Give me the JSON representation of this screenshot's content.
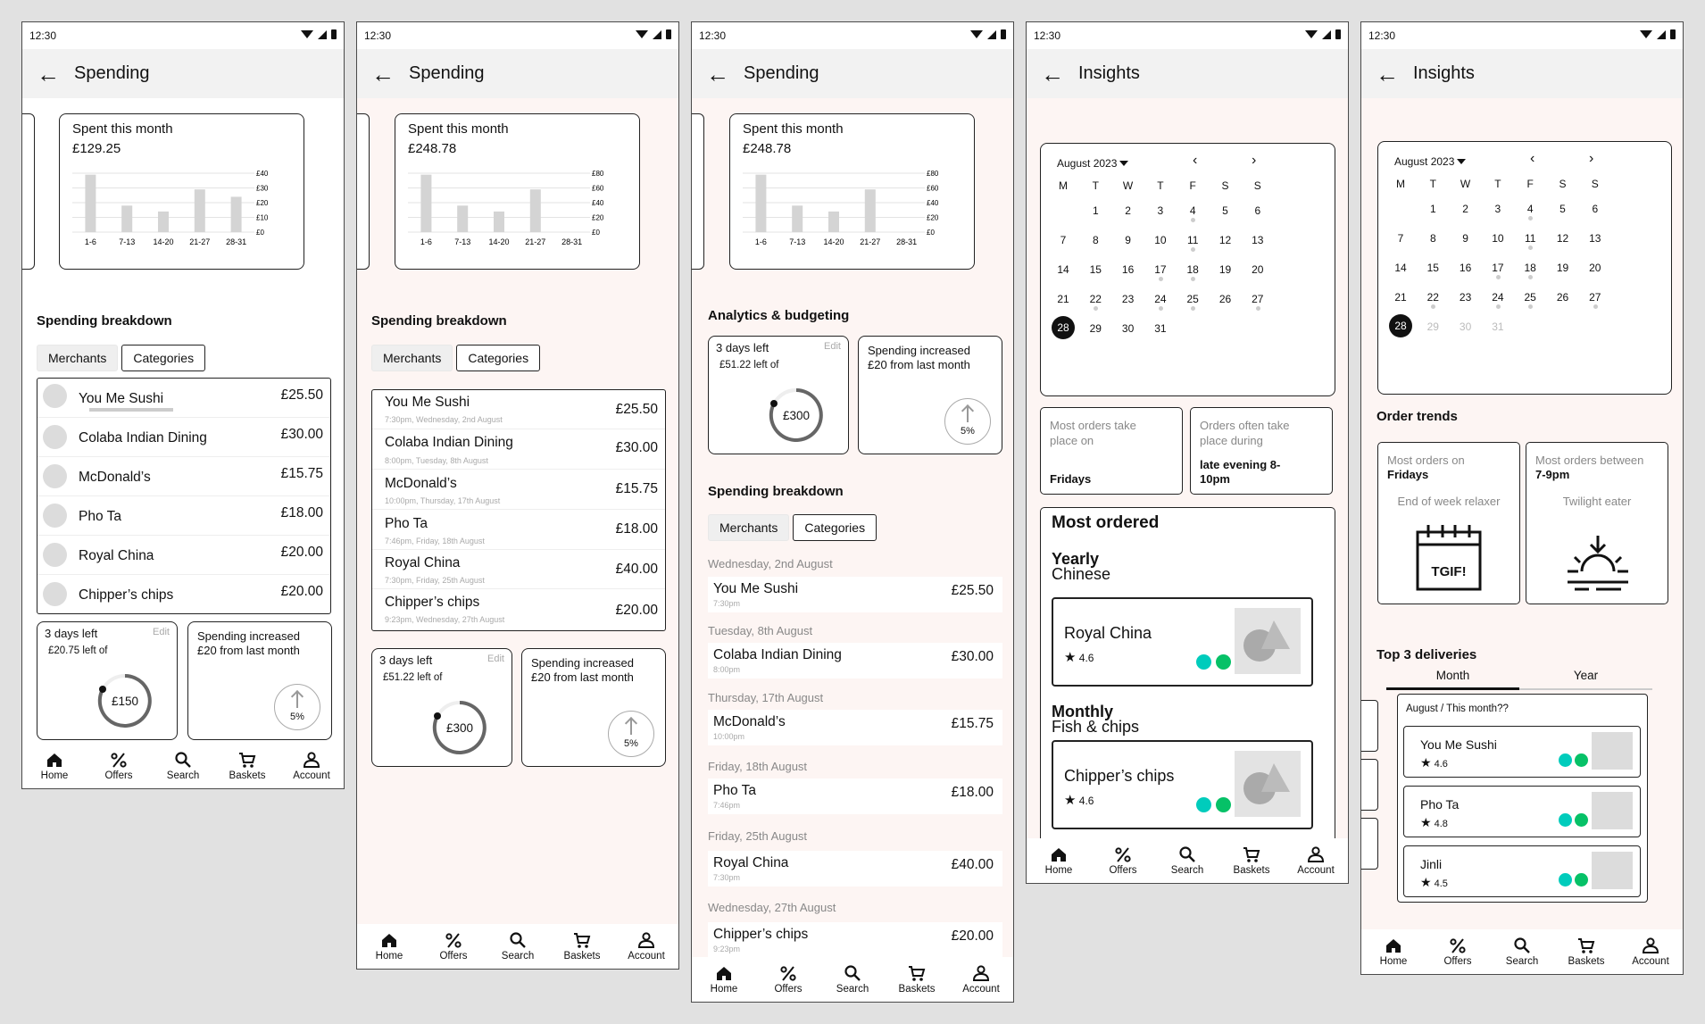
{
  "status": {
    "time": "12:30"
  },
  "nav": [
    "Home",
    "Offers",
    "Search",
    "Baskets",
    "Account"
  ],
  "screen1": {
    "title": "Spending",
    "spent_label": "Spent this month",
    "spent_amount": "£129.25",
    "chart_data": {
      "type": "bar",
      "categories": [
        "1-6",
        "7-13",
        "14-20",
        "21-27",
        "28-31"
      ],
      "values": [
        39,
        18,
        14,
        29,
        24
      ],
      "yticks": [
        "£40",
        "£30",
        "£20",
        "£10",
        "£0"
      ],
      "ylim": [
        0,
        40
      ]
    },
    "breakdown_title": "Spending breakdown",
    "tabs": [
      "Merchants",
      "Categories"
    ],
    "items": [
      {
        "name": "You Me Sushi",
        "amount": "£25.50"
      },
      {
        "name": "Colaba Indian Dining",
        "amount": "£30.00"
      },
      {
        "name": "McDonald’s",
        "amount": "£15.75"
      },
      {
        "name": "Pho Ta",
        "amount": "£18.00"
      },
      {
        "name": "Royal China",
        "amount": "£20.00"
      },
      {
        "name": "Chipper’s chips",
        "amount": "£20.00"
      }
    ],
    "budget": {
      "days": "3 days left",
      "edit": "Edit",
      "left": "£20.75 left of",
      "total": "£150"
    },
    "increase": {
      "text": "Spending increased £20 from last month",
      "pct": "5%"
    }
  },
  "screen2": {
    "title": "Spending",
    "spent_label": "Spent this month",
    "spent_amount": "£248.78",
    "chart_data": {
      "type": "bar",
      "categories": [
        "1-6",
        "7-13",
        "14-20",
        "21-27",
        "28-31"
      ],
      "values": [
        78,
        36,
        28,
        58,
        0
      ],
      "yticks": [
        "£80",
        "£60",
        "£40",
        "£20",
        "£0"
      ],
      "ylim": [
        0,
        80
      ]
    },
    "breakdown_title": "Spending breakdown",
    "tabs": [
      "Merchants",
      "Categories"
    ],
    "items": [
      {
        "name": "You Me Sushi",
        "amount": "£25.50",
        "sub": "7:30pm, Wednesday, 2nd August"
      },
      {
        "name": "Colaba Indian Dining",
        "amount": "£30.00",
        "sub": "8:00pm, Tuesday, 8th August"
      },
      {
        "name": "McDonald’s",
        "amount": "£15.75",
        "sub": "10:00pm, Thursday, 17th August"
      },
      {
        "name": "Pho Ta",
        "amount": "£18.00",
        "sub": "7:46pm, Friday, 18th August"
      },
      {
        "name": "Royal China",
        "amount": "£40.00",
        "sub": "7:30pm, Friday, 25th August"
      },
      {
        "name": "Chipper’s chips",
        "amount": "£20.00",
        "sub": "9:23pm, Wednesday, 27th August"
      }
    ],
    "budget": {
      "days": "3 days left",
      "edit": "Edit",
      "left": "£51.22 left of",
      "total": "£300"
    },
    "increase": {
      "text": "Spending increased £20 from last month",
      "pct": "5%"
    }
  },
  "screen3": {
    "title": "Spending",
    "spent_label": "Spent this month",
    "spent_amount": "£248.78",
    "chart_data": {
      "type": "bar",
      "categories": [
        "1-6",
        "7-13",
        "14-20",
        "21-27",
        "28-31"
      ],
      "values": [
        78,
        36,
        28,
        58,
        0
      ],
      "yticks": [
        "£80",
        "£60",
        "£40",
        "£20",
        "£0"
      ],
      "ylim": [
        0,
        80
      ]
    },
    "analytics_title": "Analytics & budgeting",
    "budget": {
      "days": "3 days left",
      "edit": "Edit",
      "left": "£51.22 left of",
      "total": "£300"
    },
    "increase": {
      "text": "Spending increased £20 from last month",
      "pct": "5%"
    },
    "breakdown_title": "Spending breakdown",
    "tabs": [
      "Merchants",
      "Categories"
    ],
    "groups": [
      {
        "date": "Wednesday, 2nd August",
        "name": "You Me Sushi",
        "sub": "7:30pm",
        "amount": "£25.50"
      },
      {
        "date": "Tuesday, 8th August",
        "name": "Colaba Indian Dining",
        "sub": "8:00pm",
        "amount": "£30.00"
      },
      {
        "date": "Thursday, 17th August",
        "name": "McDonald’s",
        "sub": "10:00pm",
        "amount": "£15.75"
      },
      {
        "date": "Friday, 18th August",
        "name": "Pho Ta",
        "sub": "7:46pm",
        "amount": "£18.00"
      },
      {
        "date": "Friday, 25th August",
        "name": "Royal China",
        "sub": "7:30pm",
        "amount": "£40.00"
      },
      {
        "date": "Wednesday, 27th August",
        "name": "Chipper’s chips",
        "sub": "9:23pm",
        "amount": "£20.00"
      }
    ]
  },
  "screen4": {
    "title": "Insights",
    "calendar": {
      "month": "August 2023",
      "days": [
        "M",
        "T",
        "W",
        "T",
        "F",
        "S",
        "S"
      ],
      "today": "28"
    },
    "most_orders_label": "Most orders take place on",
    "most_orders_value": "Fridays",
    "orders_during_label": "Orders often take place during",
    "orders_during_value": "late evening 8-10pm",
    "most_ordered_title": "Most ordered",
    "yearly_label": "Yearly",
    "yearly_value": "Chinese",
    "yearly_rest": {
      "name": "Royal China",
      "rating": "4.6"
    },
    "monthly_label": "Monthly",
    "monthly_value": "Fish & chips",
    "monthly_rest": {
      "name": "Chipper’s chips",
      "rating": "4.6"
    }
  },
  "screen5": {
    "title": "Insights",
    "calendar": {
      "month": "August 2023",
      "days": [
        "M",
        "T",
        "W",
        "T",
        "F",
        "S",
        "S"
      ],
      "today": "28"
    },
    "trends_title": "Order trends",
    "trend1": {
      "label": "Most orders on",
      "value": "Fridays",
      "desc": "End of week relaxer",
      "badge": "TGIF!"
    },
    "trend2": {
      "label": "Most orders between",
      "value": "7-9pm",
      "desc": "Twilight eater"
    },
    "top_title": "Top 3 deliveries",
    "tabs": [
      "Month",
      "Year"
    ],
    "list_header": "August / This month??",
    "deliveries": [
      {
        "name": "You Me Sushi",
        "rating": "4.6"
      },
      {
        "name": "Pho Ta",
        "rating": "4.8"
      },
      {
        "name": "Jinli",
        "rating": "4.5"
      }
    ]
  },
  "colors": {
    "bg": "#e1e1e1",
    "pink": "#fdf5f3",
    "deliveroo": "#00ccbc",
    "ubereats": "#06c167"
  }
}
